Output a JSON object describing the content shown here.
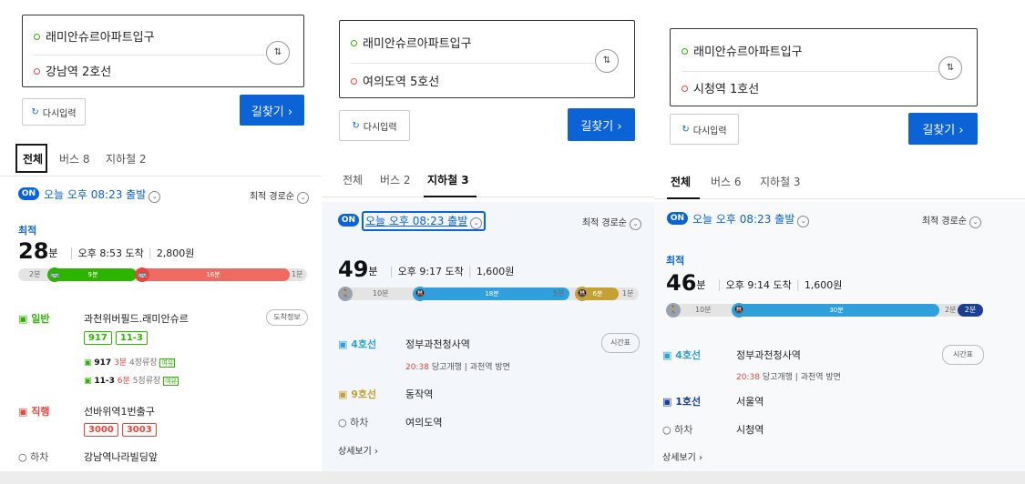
{
  "panel1": {
    "start": "래미안슈르아파트입구",
    "dest": "강남역 2호선",
    "swap_icon": "swap-icon",
    "reset_label": "다시입력",
    "find_label": "길찾기 ›",
    "tabs": [
      "전체",
      "버스 8",
      "지하철 2"
    ],
    "on_label": "ON",
    "departure": "오늘 오후 08:23 출발",
    "sort": "최적 경로순",
    "best": "최적",
    "minutes": "28",
    "minutes_unit": "분",
    "arrive": "오후 8:53 도착",
    "fare": "2,800원",
    "bar": {
      "seg1": "9분",
      "seg2": "16분",
      "start_label": "2분",
      "end_label": "1분"
    },
    "leg1_type": "일반",
    "leg1_stop": "과천위버필드.래미안슈르",
    "leg1_info": "도착정보",
    "leg1_routes": [
      "917",
      "11-3"
    ],
    "bus_a": {
      "no": "917",
      "time": "3분",
      "stops": "4정류장",
      "tag": "여유"
    },
    "bus_b": {
      "no": "11-3",
      "time": "6분",
      "stops": "5정류장",
      "tag": "여유"
    },
    "leg2_type": "직행",
    "leg2_stop": "선바위역1번출구",
    "leg2_routes": [
      "3000",
      "3003"
    ],
    "off_label": "하차",
    "off_stop": "강남역나라빌딩앞"
  },
  "panel2": {
    "start": "래미안슈르아파트입구",
    "dest": "여의도역 5호선",
    "reset_label": "다시입력",
    "find_label": "길찾기 ›",
    "tabs": [
      "전체",
      "버스 2",
      "지하철 3"
    ],
    "on_label": "ON",
    "departure": "오늘 오후 08:23 출발",
    "sort": "최적 경로순",
    "minutes": "49",
    "minutes_unit": "분",
    "arrive": "오후 9:17 도착",
    "fare": "1,600원",
    "bar": {
      "walk1": "10분",
      "seg1": "18분",
      "walk2": "5분",
      "seg2": "6분",
      "end_label": "1분"
    },
    "leg1_line": "4호선",
    "leg1_stop": "정부과천청사역",
    "leg1_info": "시간표",
    "leg1_time": "20:38",
    "leg1_dir": "당고개행",
    "leg1_way": "과천역 방면",
    "leg2_line": "9호선",
    "leg2_stop": "동작역",
    "off_label": "하차",
    "off_stop": "여의도역",
    "detail": "상세보기 ›"
  },
  "panel3": {
    "start": "래미안슈르아파트입구",
    "dest": "시청역 1호선",
    "reset_label": "다시입력",
    "find_label": "길찾기 ›",
    "tabs": [
      "전체",
      "버스 6",
      "지하철 3"
    ],
    "on_label": "ON",
    "departure": "오늘 오후 08:23 출발",
    "sort": "최적 경로순",
    "best": "최적",
    "minutes": "46",
    "minutes_unit": "분",
    "arrive": "오후 9:14 도착",
    "fare": "1,600원",
    "bar": {
      "walk1": "10분",
      "seg1": "30분",
      "end_label": "2분",
      "seg2": "2분"
    },
    "leg1_line": "4호선",
    "leg1_stop": "정부과천청사역",
    "leg1_info": "시간표",
    "leg1_time": "20:38",
    "leg1_dir": "당고개행",
    "leg1_way": "과천역 방면",
    "leg2_line": "1호선",
    "leg2_stop": "서울역",
    "off_label": "하차",
    "off_stop": "시청역",
    "detail": "상세보기 ›"
  },
  "colors": {
    "accent": "#0b63d6",
    "bus_green": "#2db400",
    "bus_red": "#e8463d",
    "line4": "#2fa0dc",
    "line9": "#c5a033",
    "line1": "#1b3f95"
  }
}
